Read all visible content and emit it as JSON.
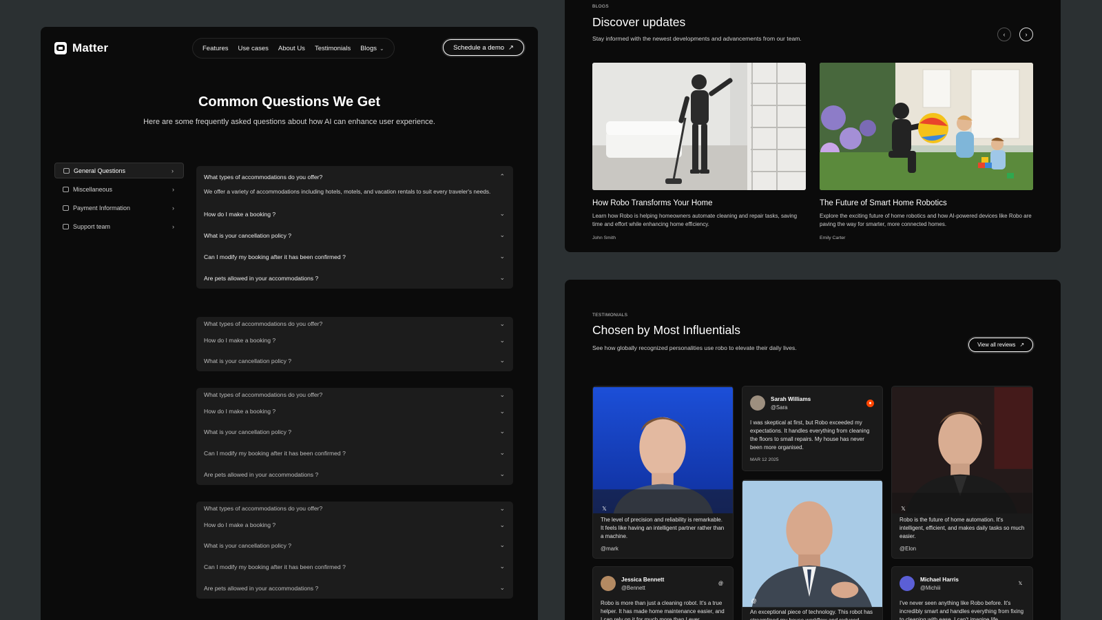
{
  "nav": {
    "brand": "Matter",
    "items": [
      "Features",
      "Use cases",
      "About Us",
      "Testimonials",
      "Blogs"
    ],
    "cta": "Schedule a demo",
    "cta_icon": "arrow-up-right-icon"
  },
  "faq": {
    "title": "Common Questions We Get",
    "subtitle": "Here are some frequently asked questions about how AI can enhance user experience.",
    "categories": [
      {
        "label": "General Questions",
        "icon": "inbox-icon"
      },
      {
        "label": "Miscellaneous",
        "icon": "lock-icon"
      },
      {
        "label": "Payment Information",
        "icon": "card-icon"
      },
      {
        "label": "Support team",
        "icon": "headphones-icon"
      }
    ],
    "group1": {
      "open_question": "What types of accommodations do you offer?",
      "open_answer": "We offer a variety of accommodations including hotels, motels, and vacation rentals to suit every traveler's needs.",
      "questions": [
        "How do I make a booking ?",
        "What is your cancellation policy ?",
        "Can I modify my booking after it has been confirmed ?",
        "Are pets allowed in your accommodations ?"
      ]
    },
    "group2": [
      "What types of accommodations do you offer?",
      "How do I make a booking ?",
      "What is your cancellation policy ?"
    ],
    "group3": [
      "What types of accommodations do you offer?",
      "How do I make a booking ?",
      "What is your cancellation policy ?",
      "Can I modify my booking after it has been confirmed ?",
      "Are pets allowed in your accommodations ?"
    ],
    "group4": [
      "What types of accommodations do you offer?",
      "How do I make a booking ?",
      "What is your cancellation policy ?",
      "Can I modify my booking after it has been confirmed ?",
      "Are pets allowed in your accommodations ?"
    ]
  },
  "blogs": {
    "eyebrow": "BLOGS",
    "title": "Discover updates",
    "subtitle": "Stay informed with the newest developments and advancements from our team.",
    "prev_icon": "chevron-left-icon",
    "next_icon": "chevron-right-icon",
    "posts": [
      {
        "title": "How Robo Transforms Your Home",
        "desc": "Learn how Robo is helping homeowners automate cleaning and repair tasks, saving time and effort while enhancing home efficiency.",
        "author": "John Smith"
      },
      {
        "title": "The Future of Smart Home Robotics",
        "desc": "Explore the exciting future of home robotics and how AI-powered devices like Robo are paving the way for smarter, more connected homes.",
        "author": "Emily Carter"
      }
    ]
  },
  "testimonials": {
    "eyebrow": "TESTIMONIALS",
    "title": "Chosen by Most Influentials",
    "subtitle": "See how globally recognized personalities use robo to elevate their daily lives.",
    "cta": "View all reviews",
    "mark": {
      "quote": "The level of precision and reliability is remarkable. It feels like having an intelligent partner rather than a machine.",
      "handle": "@mark",
      "source_icon": "x-icon"
    },
    "sara": {
      "name": "Sarah Williams",
      "handle": "@Sara",
      "text": "I was skeptical at first, but Robo exceeded my expectations. It handles everything from cleaning the floors to small repairs. My house has never been more organised.",
      "date": "MAR 12 2025",
      "source_icon": "reddit-icon"
    },
    "elon": {
      "quote": "Robo is the future of home automation. It's intelligent, efficient, and makes daily tasks so much easier.",
      "handle": "@Elon",
      "source_icon": "x-icon"
    },
    "jeff": {
      "quote": "An exceptional piece of technology. This robot has streamlined my house workflow and reduced",
      "source_icon": "threads-icon"
    },
    "jessica": {
      "name": "Jessica Bennett",
      "handle": "@Bennett",
      "text": "Robo is more than just a cleaning robot. It's a true helper. It has made home maintenance easier, and I can rely on it for much more than I ever",
      "source_icon": "threads-icon"
    },
    "michael": {
      "name": "Michael Harris",
      "handle": "@Michiii",
      "text": "I've never seen anything like Robo before. It's incredibly smart and handles everything from fixing to cleaning with ease. I can't imagine life",
      "source_icon": "x-icon"
    }
  },
  "colors": {
    "background": "#2b3032",
    "panel": "#0b0b0b",
    "accordion": "#1c1c1c",
    "reddit": "#ff4500"
  }
}
